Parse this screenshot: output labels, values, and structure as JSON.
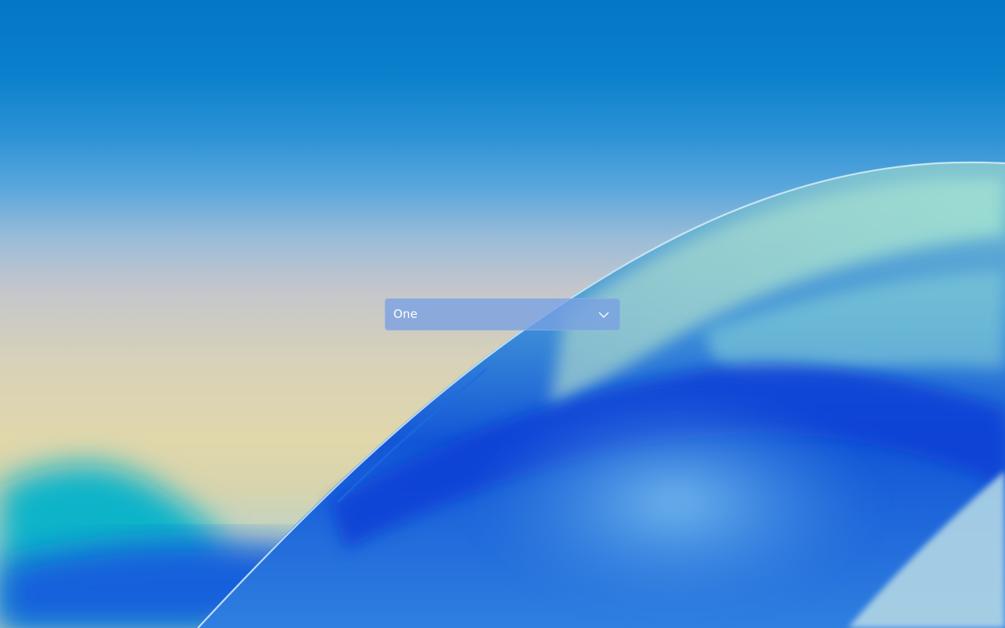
{
  "combobox": {
    "selected": "One",
    "chevron_icon": "chevron-down-icon"
  },
  "colors": {
    "combo_background": "#7aa0e1",
    "combo_text": "#ffffff",
    "sky_top": "#0477c6",
    "horizon": "#e0d7ab",
    "wave": "#1a5fd8"
  }
}
